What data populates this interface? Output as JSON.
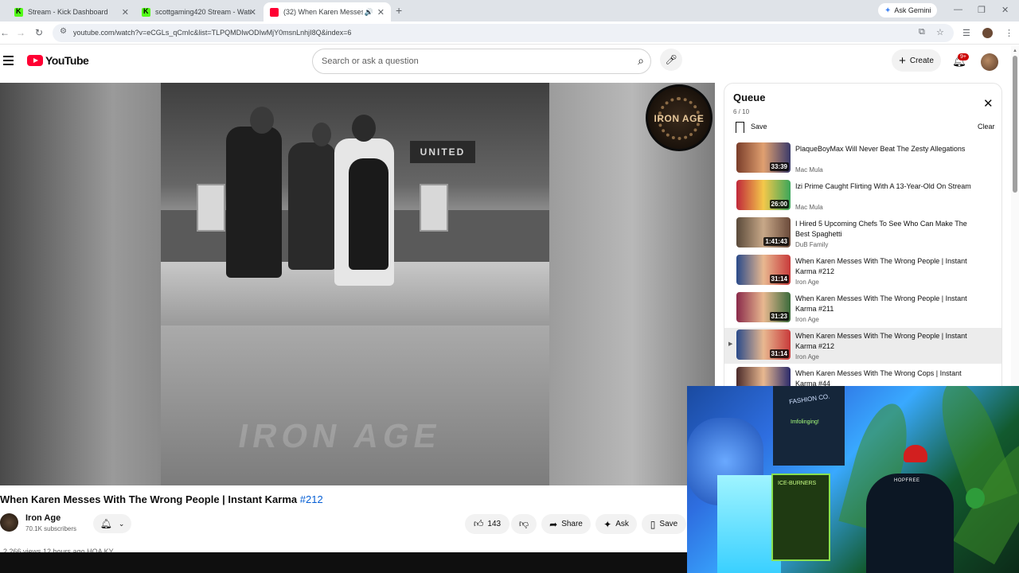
{
  "browser": {
    "tabs": [
      {
        "title": "Stream - Kick Dashboard",
        "favicon": "kick-icon",
        "active": false
      },
      {
        "title": "scottgaming420 Stream - Watc",
        "favicon": "kick-icon",
        "active": false
      },
      {
        "title": "(32) When Karen Messes W",
        "favicon": "youtube-icon",
        "active": true
      }
    ],
    "gemini_label": "Ask Gemini",
    "url": "youtube.com/watch?v=eCGLs_qCmIc&list=TLPQMDIwODIwMjY0msnLnhjI8Q&index=6"
  },
  "masthead": {
    "logo_text": "YouTube",
    "search_placeholder": "Search or ask a question",
    "create_label": "Create",
    "notification_count": "9+"
  },
  "player": {
    "watermark": "IRON AGE",
    "overlay_logo_text": "IRON AGE",
    "sign_text": "UNITED"
  },
  "video": {
    "title": "When Karen Messes With The Wrong People | Instant Karma",
    "hashtag": "#212",
    "channel_name": "Iron Age",
    "subscribers": "70.1K subscribers",
    "likes": "143",
    "share_label": "Share",
    "ask_label": "Ask",
    "save_label": "Save",
    "views_line": "2,266 views  12 hours ago  HOA KY"
  },
  "queue": {
    "title": "Queue",
    "position": "6 / 10",
    "save_label": "Save",
    "clear_label": "Clear",
    "items": [
      {
        "title": "PlaqueBoyMax Will Never Beat The Zesty Allegations",
        "channel": "Mac Mula",
        "duration": "33:39",
        "selected": false
      },
      {
        "title": "Izi Prime Caught Flirting With A 13-Year-Old On Stream",
        "channel": "Mac Mula",
        "duration": "26:00",
        "selected": false
      },
      {
        "title": "I Hired 5 Upcoming Chefs To See Who Can Make The Best Spaghetti",
        "channel": "DuB Family",
        "duration": "1:41:43",
        "selected": false
      },
      {
        "title": "When Karen Messes With The Wrong People | Instant Karma #212",
        "channel": "Iron Age",
        "duration": "31:14",
        "selected": false
      },
      {
        "title": "When Karen Messes With The Wrong People | Instant Karma #211",
        "channel": "Iron Age",
        "duration": "31:23",
        "selected": false
      },
      {
        "title": "When Karen Messes With The Wrong People | Instant Karma #212",
        "channel": "Iron Age",
        "duration": "31:14",
        "selected": true
      },
      {
        "title": "When Karen Messes With The Wrong Cops | Instant Karma #44",
        "channel": "Iron Age",
        "duration": "",
        "selected": false
      }
    ]
  },
  "webcam": {
    "shirt_text_1": "FASHION CO.",
    "shirt_text_2": "Imfolinging!",
    "box_text": "ICE-BURNERS",
    "hat_text": "HOPFREE"
  },
  "colors": {
    "youtube_red": "#ff0033",
    "kick_green": "#53fc18",
    "link_blue": "#065fd4"
  }
}
